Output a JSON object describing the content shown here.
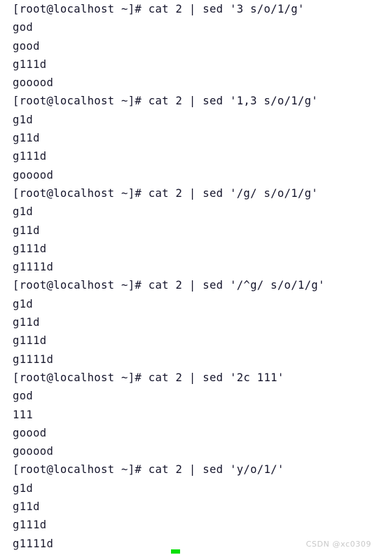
{
  "terminal": {
    "background_color": "#ffffff",
    "text_color": "#1a1a2e",
    "cursor_color": "#00e000",
    "prompt": "[root@localhost ~]# ",
    "lines": [
      {
        "type": "prompt",
        "text": "[root@localhost ~]# cat 2 | sed '3 s/o/1/g'"
      },
      {
        "type": "output",
        "text": "god"
      },
      {
        "type": "output",
        "text": "good"
      },
      {
        "type": "output",
        "text": "g111d"
      },
      {
        "type": "output",
        "text": "gooood"
      },
      {
        "type": "prompt",
        "text": "[root@localhost ~]# cat 2 | sed '1,3 s/o/1/g'"
      },
      {
        "type": "output",
        "text": "g1d"
      },
      {
        "type": "output",
        "text": "g11d"
      },
      {
        "type": "output",
        "text": "g111d"
      },
      {
        "type": "output",
        "text": "gooood"
      },
      {
        "type": "prompt",
        "text": "[root@localhost ~]# cat 2 | sed '/g/ s/o/1/g'"
      },
      {
        "type": "output",
        "text": "g1d"
      },
      {
        "type": "output",
        "text": "g11d"
      },
      {
        "type": "output",
        "text": "g111d"
      },
      {
        "type": "output",
        "text": "g1111d"
      },
      {
        "type": "prompt",
        "text": "[root@localhost ~]# cat 2 | sed '/^g/ s/o/1/g'"
      },
      {
        "type": "output",
        "text": "g1d"
      },
      {
        "type": "output",
        "text": "g11d"
      },
      {
        "type": "output",
        "text": "g111d"
      },
      {
        "type": "output",
        "text": "g1111d"
      },
      {
        "type": "prompt",
        "text": "[root@localhost ~]# cat 2 | sed '2c 111'"
      },
      {
        "type": "output",
        "text": "god"
      },
      {
        "type": "output",
        "text": "111"
      },
      {
        "type": "output",
        "text": "goood"
      },
      {
        "type": "output",
        "text": "gooood"
      },
      {
        "type": "prompt",
        "text": "[root@localhost ~]# cat 2 | sed 'y/o/1/'"
      },
      {
        "type": "output",
        "text": "g1d"
      },
      {
        "type": "output",
        "text": "g11d"
      },
      {
        "type": "output",
        "text": "g111d"
      },
      {
        "type": "output",
        "text": "g1111d"
      }
    ]
  },
  "watermark": {
    "text": "CSDN @xc0309"
  }
}
